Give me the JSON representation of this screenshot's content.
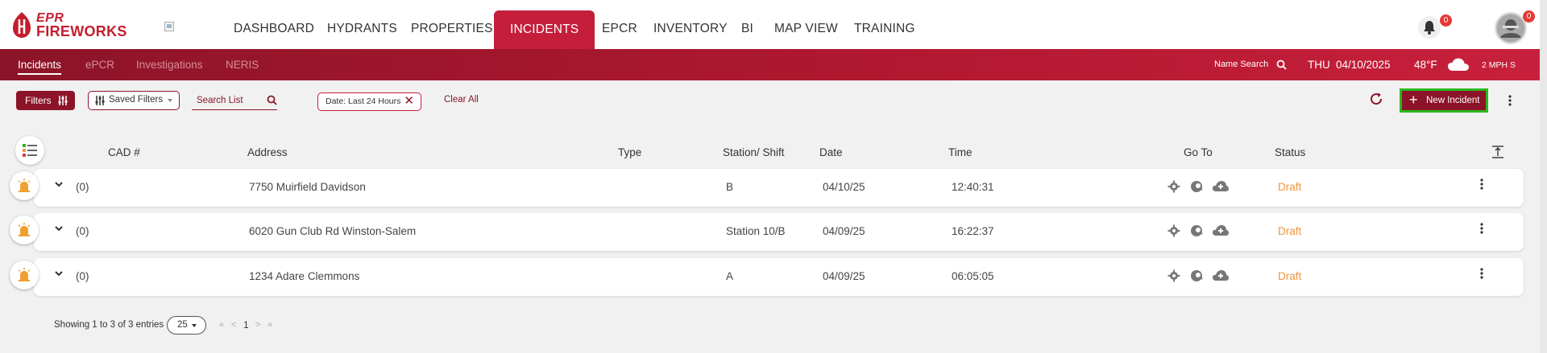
{
  "brand": {
    "line1": "EPR",
    "line2": "FIREWORKS"
  },
  "nav": {
    "items": [
      {
        "label": "DASHBOARD"
      },
      {
        "label": "HYDRANTS"
      },
      {
        "label": "PROPERTIES"
      },
      {
        "label": "INCIDENTS",
        "active": true
      },
      {
        "label": "EPCR"
      },
      {
        "label": "INVENTORY"
      },
      {
        "label": "BI"
      },
      {
        "label": "MAP VIEW"
      },
      {
        "label": "TRAINING"
      }
    ],
    "notifications_count": "0",
    "profile_badge": "0"
  },
  "subnav": {
    "tabs": [
      {
        "label": "Incidents",
        "active": true
      },
      {
        "label": "ePCR"
      },
      {
        "label": "Investigations"
      },
      {
        "label": "NERIS"
      }
    ],
    "name_search": "Name Search",
    "day": "THU",
    "date": "04/10/2025",
    "temperature": "48°F",
    "wind": "2 MPH S"
  },
  "toolbar": {
    "filters_label": "Filters",
    "saved_filters_label": "Saved Filters",
    "search_placeholder": "Search List",
    "active_filter_chip": "Date: Last 24 Hours",
    "clear_all_label": "Clear All",
    "new_incident_label": "New Incident"
  },
  "table": {
    "headers": {
      "cad": "CAD #",
      "address": "Address",
      "type": "Type",
      "station_shift": "Station/ Shift",
      "date": "Date",
      "time": "Time",
      "goto": "Go To",
      "status": "Status"
    },
    "rows": [
      {
        "count": "(0)",
        "address": "7750 Muirfield Davidson",
        "type": "",
        "station_shift": "B",
        "date": "04/10/25",
        "time": "12:40:31",
        "status": "Draft"
      },
      {
        "count": "(0)",
        "address": "6020 Gun Club Rd Winston-Salem",
        "type": "",
        "station_shift": "Station 10/B",
        "date": "04/09/25",
        "time": "16:22:37",
        "status": "Draft"
      },
      {
        "count": "(0)",
        "address": "1234 Adare Clemmons",
        "type": "",
        "station_shift": "A",
        "date": "04/09/25",
        "time": "06:05:05",
        "status": "Draft"
      }
    ]
  },
  "pagination": {
    "showing": "Showing 1 to 3 of 3 entries",
    "page_size": "25",
    "first": "«",
    "prev": "<",
    "current": "1",
    "next": ">",
    "last": "»"
  },
  "colors": {
    "brand_red": "#c41e3a",
    "dark_red": "#8c1428",
    "status_draft": "#f0943a",
    "highlight_green": "#2bb81c"
  }
}
